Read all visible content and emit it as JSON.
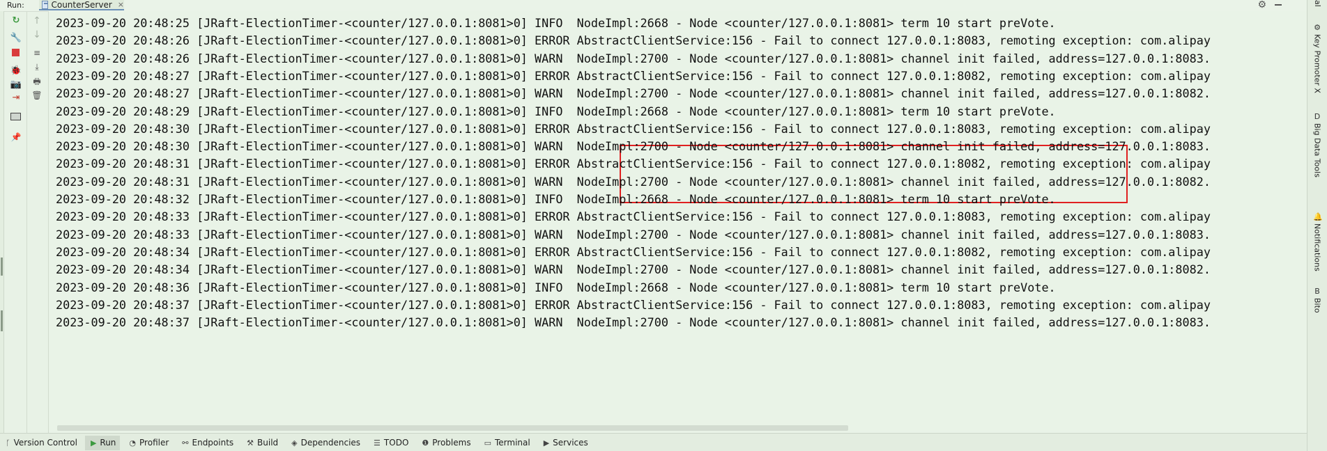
{
  "run_header": {
    "label": "Run:",
    "tab_label": "CounterServer",
    "close_glyph": "×"
  },
  "left_toolbar": {
    "buttons": [
      {
        "name": "rerun-icon",
        "glyph": "↻"
      },
      {
        "name": "wrench-icon",
        "glyph": "🔧"
      },
      {
        "name": "stop-icon",
        "glyph": ""
      },
      {
        "name": "debug-icon",
        "glyph": "🐞"
      },
      {
        "name": "camera-icon",
        "glyph": "📷"
      },
      {
        "name": "exit-icon",
        "glyph": "⇥"
      },
      {
        "name": "layout-icon",
        "glyph": ""
      },
      {
        "name": "pin-icon",
        "glyph": "📌"
      }
    ]
  },
  "console_toolbar": {
    "buttons": [
      {
        "name": "scroll-up-icon",
        "glyph": "↑"
      },
      {
        "name": "scroll-down-icon",
        "glyph": "↓"
      },
      {
        "name": "soft-wrap-icon",
        "glyph": "≡"
      },
      {
        "name": "scroll-to-end-icon",
        "glyph": "⤓"
      },
      {
        "name": "print-icon",
        "glyph": "🖶"
      },
      {
        "name": "trash-icon",
        "glyph": "🗑"
      }
    ]
  },
  "console": {
    "lines": [
      "2023-09-20 20:48:25 [JRaft-ElectionTimer-<counter/127.0.0.1:8081>0] INFO  NodeImpl:2668 - Node <counter/127.0.0.1:8081> term 10 start preVote.",
      "2023-09-20 20:48:26 [JRaft-ElectionTimer-<counter/127.0.0.1:8081>0] ERROR AbstractClientService:156 - Fail to connect 127.0.0.1:8083, remoting exception: com.alipay",
      "2023-09-20 20:48:26 [JRaft-ElectionTimer-<counter/127.0.0.1:8081>0] WARN  NodeImpl:2700 - Node <counter/127.0.0.1:8081> channel init failed, address=127.0.0.1:8083.",
      "2023-09-20 20:48:27 [JRaft-ElectionTimer-<counter/127.0.0.1:8081>0] ERROR AbstractClientService:156 - Fail to connect 127.0.0.1:8082, remoting exception: com.alipay",
      "2023-09-20 20:48:27 [JRaft-ElectionTimer-<counter/127.0.0.1:8081>0] WARN  NodeImpl:2700 - Node <counter/127.0.0.1:8081> channel init failed, address=127.0.0.1:8082.",
      "2023-09-20 20:48:29 [JRaft-ElectionTimer-<counter/127.0.0.1:8081>0] INFO  NodeImpl:2668 - Node <counter/127.0.0.1:8081> term 10 start preVote.",
      "2023-09-20 20:48:30 [JRaft-ElectionTimer-<counter/127.0.0.1:8081>0] ERROR AbstractClientService:156 - Fail to connect 127.0.0.1:8083, remoting exception: com.alipay",
      "2023-09-20 20:48:30 [JRaft-ElectionTimer-<counter/127.0.0.1:8081>0] WARN  NodeImpl:2700 - Node <counter/127.0.0.1:8081> channel init failed, address=127.0.0.1:8083.",
      "2023-09-20 20:48:31 [JRaft-ElectionTimer-<counter/127.0.0.1:8081>0] ERROR AbstractClientService:156 - Fail to connect 127.0.0.1:8082, remoting exception: com.alipay",
      "2023-09-20 20:48:31 [JRaft-ElectionTimer-<counter/127.0.0.1:8081>0] WARN  NodeImpl:2700 - Node <counter/127.0.0.1:8081> channel init failed, address=127.0.0.1:8082.",
      "2023-09-20 20:48:32 [JRaft-ElectionTimer-<counter/127.0.0.1:8081>0] INFO  NodeImpl:2668 - Node <counter/127.0.0.1:8081> term 10 start preVote.",
      "2023-09-20 20:48:33 [JRaft-ElectionTimer-<counter/127.0.0.1:8081>0] ERROR AbstractClientService:156 - Fail to connect 127.0.0.1:8083, remoting exception: com.alipay",
      "2023-09-20 20:48:33 [JRaft-ElectionTimer-<counter/127.0.0.1:8081>0] WARN  NodeImpl:2700 - Node <counter/127.0.0.1:8081> channel init failed, address=127.0.0.1:8083.",
      "2023-09-20 20:48:34 [JRaft-ElectionTimer-<counter/127.0.0.1:8081>0] ERROR AbstractClientService:156 - Fail to connect 127.0.0.1:8082, remoting exception: com.alipay",
      "2023-09-20 20:48:34 [JRaft-ElectionTimer-<counter/127.0.0.1:8081>0] WARN  NodeImpl:2700 - Node <counter/127.0.0.1:8081> channel init failed, address=127.0.0.1:8082.",
      "2023-09-20 20:48:36 [JRaft-ElectionTimer-<counter/127.0.0.1:8081>0] INFO  NodeImpl:2668 - Node <counter/127.0.0.1:8081> term 10 start preVote.",
      "2023-09-20 20:48:37 [JRaft-ElectionTimer-<counter/127.0.0.1:8081>0] ERROR AbstractClientService:156 - Fail to connect 127.0.0.1:8083, remoting exception: com.alipay",
      "2023-09-20 20:48:37 [JRaft-ElectionTimer-<counter/127.0.0.1:8081>0] WARN  NodeImpl:2700 - Node <counter/127.0.0.1:8081> channel init failed, address=127.0.0.1:8083."
    ],
    "highlight_color": "#e02020"
  },
  "right_sidebar": {
    "top_label": "al",
    "items": [
      {
        "name": "key-promoter-x",
        "label": "Key Promoter X",
        "glyph": "⚙"
      },
      {
        "name": "big-data-tools",
        "label": "Big Data Tools",
        "glyph": "D"
      },
      {
        "name": "notifications",
        "label": "Notifications",
        "glyph": "🔔"
      },
      {
        "name": "bito",
        "label": "Bito",
        "glyph": "B"
      }
    ]
  },
  "bottom_bar": {
    "items": [
      {
        "name": "version-control",
        "label": "Version Control",
        "glyph": "ᚴ"
      },
      {
        "name": "run",
        "label": "Run",
        "glyph": "▶"
      },
      {
        "name": "profiler",
        "label": "Profiler",
        "glyph": "◔"
      },
      {
        "name": "endpoints",
        "label": "Endpoints",
        "glyph": "⚯"
      },
      {
        "name": "build",
        "label": "Build",
        "glyph": "⚒"
      },
      {
        "name": "dependencies",
        "label": "Dependencies",
        "glyph": "◈"
      },
      {
        "name": "todo",
        "label": "TODO",
        "glyph": "☰"
      },
      {
        "name": "problems",
        "label": "Problems",
        "glyph": "❶"
      },
      {
        "name": "terminal",
        "label": "Terminal",
        "glyph": "▭"
      },
      {
        "name": "services",
        "label": "Services",
        "glyph": "▶"
      }
    ],
    "active": "Run"
  }
}
